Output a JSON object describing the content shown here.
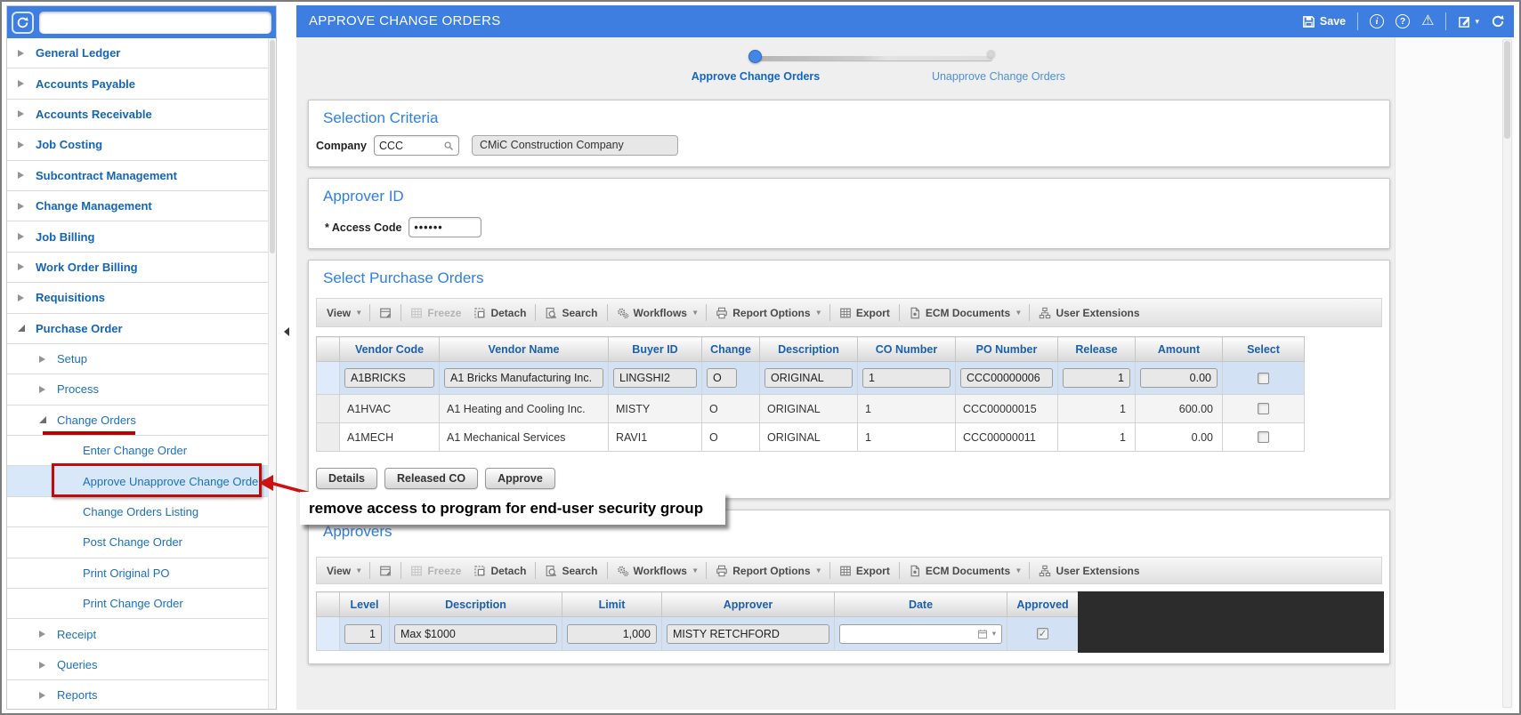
{
  "colors": {
    "accent": "#3e7ee1",
    "selected_row": "#d2e2f4",
    "annotation_red": "#bf0b0b",
    "link_blue": "#1a70c0"
  },
  "glyphs": {
    "caret": "▾",
    "warning": "⚠",
    "info": "i",
    "help": "?"
  },
  "sidebar": {
    "search_placeholder": "",
    "items": [
      {
        "label": "General Ledger",
        "level": 1,
        "expanded": false
      },
      {
        "label": "Accounts Payable",
        "level": 1,
        "expanded": false
      },
      {
        "label": "Accounts Receivable",
        "level": 1,
        "expanded": false
      },
      {
        "label": "Job Costing",
        "level": 1,
        "expanded": false
      },
      {
        "label": "Subcontract Management",
        "level": 1,
        "expanded": false
      },
      {
        "label": "Change Management",
        "level": 1,
        "expanded": false
      },
      {
        "label": "Job Billing",
        "level": 1,
        "expanded": false
      },
      {
        "label": "Work Order Billing",
        "level": 1,
        "expanded": false
      },
      {
        "label": "Requisitions",
        "level": 1,
        "expanded": false
      },
      {
        "label": "Purchase Order",
        "level": 1,
        "expanded": true
      },
      {
        "label": "Setup",
        "level": 2,
        "expanded": false
      },
      {
        "label": "Process",
        "level": 2,
        "expanded": false
      },
      {
        "label": "Change Orders",
        "level": 2,
        "expanded": true
      },
      {
        "label": "Enter Change Order",
        "level": 3
      },
      {
        "label": "Approve Unapprove Change Orders",
        "level": 3,
        "selected": true
      },
      {
        "label": "Change Orders Listing",
        "level": 3
      },
      {
        "label": "Post Change Order",
        "level": 3
      },
      {
        "label": "Print Original PO",
        "level": 3
      },
      {
        "label": "Print Change Order",
        "level": 3
      },
      {
        "label": "Receipt",
        "level": 2,
        "expanded": false
      },
      {
        "label": "Queries",
        "level": 2,
        "expanded": false
      },
      {
        "label": "Reports",
        "level": 2,
        "expanded": false
      }
    ]
  },
  "header": {
    "title": "APPROVE CHANGE ORDERS",
    "save_label": "Save"
  },
  "stepper": {
    "steps": [
      {
        "label": "Approve Change Orders",
        "state": "active"
      },
      {
        "label": "Unapprove Change Orders",
        "state": "upcoming"
      }
    ]
  },
  "selection_criteria": {
    "title": "Selection Criteria",
    "company_label": "Company",
    "company_code": "CCC",
    "company_name": "CMiC Construction Company"
  },
  "approver_id": {
    "title": "Approver ID",
    "required_mark": "*",
    "access_code_label": "Access Code",
    "access_code_value": "••••••"
  },
  "toolbar": {
    "view": "View",
    "freeze": "Freeze",
    "detach": "Detach",
    "search": "Search",
    "workflows": "Workflows",
    "report_options": "Report Options",
    "export": "Export",
    "ecm_documents": "ECM Documents",
    "user_extensions": "User Extensions"
  },
  "po_section": {
    "title": "Select Purchase Orders",
    "columns": [
      "Vendor Code",
      "Vendor Name",
      "Buyer ID",
      "Change",
      "Description",
      "CO Number",
      "PO Number",
      "Release",
      "Amount",
      "Select"
    ],
    "rows": [
      {
        "vendor_code": "A1BRICKS",
        "vendor_name": "A1 Bricks Manufacturing Inc.",
        "buyer_id": "LINGSHI2",
        "change": "O",
        "description": "ORIGINAL",
        "co_number": "1",
        "po_number": "CCC00000006",
        "release": "1",
        "amount": "0.00",
        "selected": false
      },
      {
        "vendor_code": "A1HVAC",
        "vendor_name": "A1 Heating and Cooling Inc.",
        "buyer_id": "MISTY",
        "change": "O",
        "description": "ORIGINAL",
        "co_number": "1",
        "po_number": "CCC00000015",
        "release": "1",
        "amount": "600.00",
        "selected": false
      },
      {
        "vendor_code": "A1MECH",
        "vendor_name": "A1 Mechanical Services",
        "buyer_id": "RAVI1",
        "change": "O",
        "description": "ORIGINAL",
        "co_number": "1",
        "po_number": "CCC00000011",
        "release": "1",
        "amount": "0.00",
        "selected": false
      }
    ],
    "buttons": [
      "Details",
      "Released CO",
      "Approve"
    ]
  },
  "approvers_section": {
    "title": "Approvers",
    "columns": [
      "Level",
      "Description",
      "Limit",
      "Approver",
      "Date",
      "Approved"
    ],
    "row": {
      "level": "1",
      "description": "Max $1000",
      "limit": "1,000",
      "approver": "MISTY RETCHFORD",
      "date": "",
      "approved": true,
      "approved_glyph": "✓"
    }
  },
  "annotation": {
    "note": "remove access to program for end-user security group"
  }
}
